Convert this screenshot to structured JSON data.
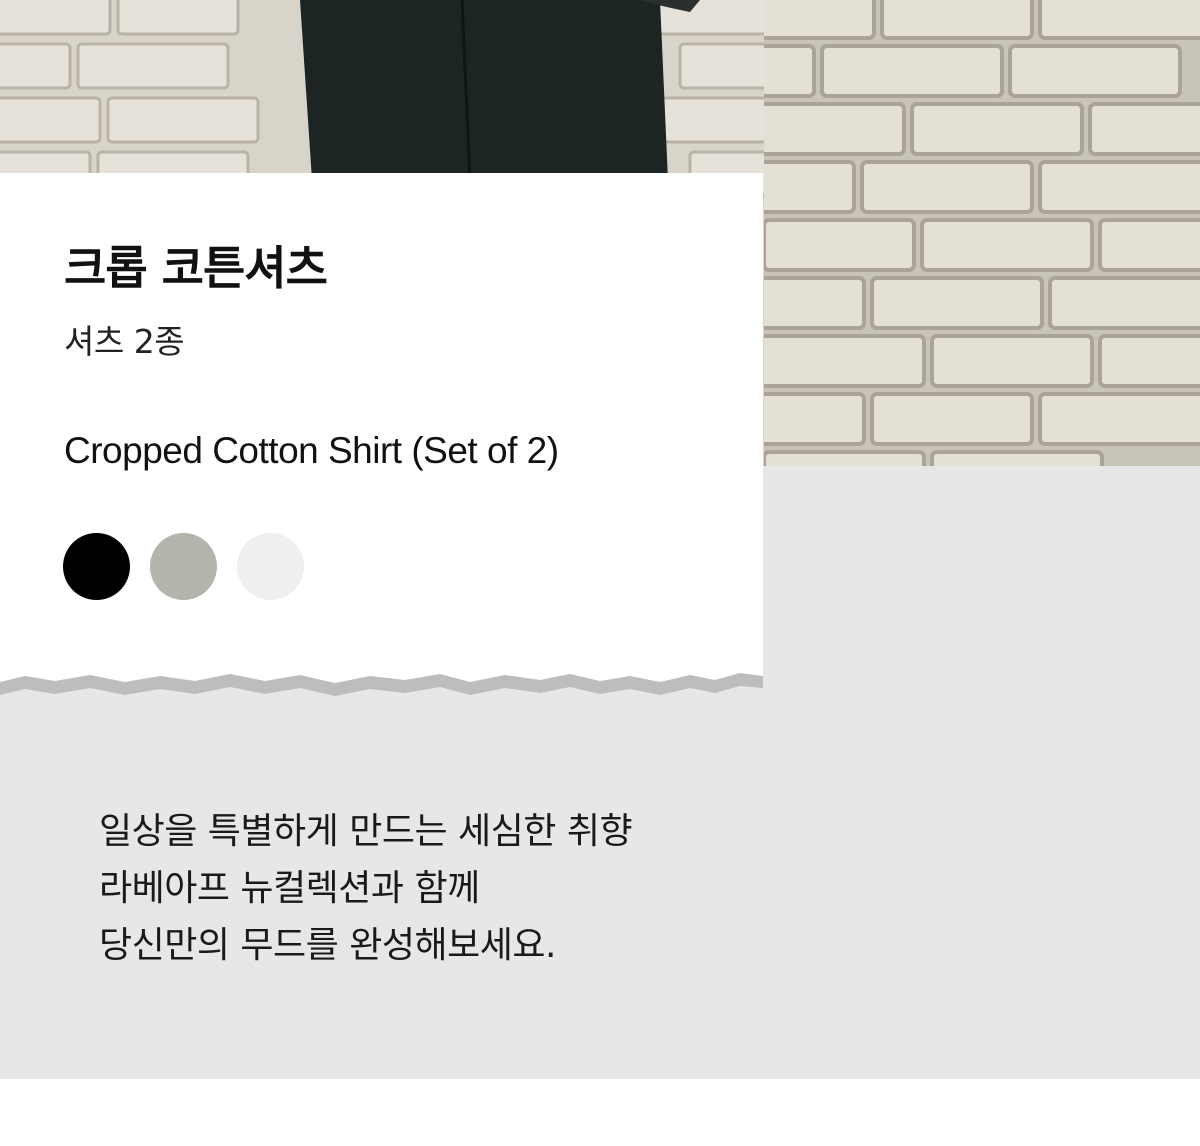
{
  "product": {
    "name_ko": "크롭 코튼셔츠",
    "subtitle_ko": "셔츠 2종",
    "name_en": "Cropped Cotton Shirt (Set of 2)"
  },
  "color_options": [
    {
      "name": "black",
      "hex": "#000000"
    },
    {
      "name": "gray",
      "hex": "#b4b4ad"
    },
    {
      "name": "white",
      "hex": "#efefef"
    }
  ],
  "description": {
    "lines": [
      "일상을 특별하게 만드는 세심한 취향",
      "라베아프 뉴컬렉션과 함께",
      "당신만의 무드를 완성해보세요."
    ]
  },
  "colors": {
    "background": "#e7e7e7",
    "card": "#ffffff",
    "wall": "#dcd8ce",
    "pants": "#1c2424"
  }
}
